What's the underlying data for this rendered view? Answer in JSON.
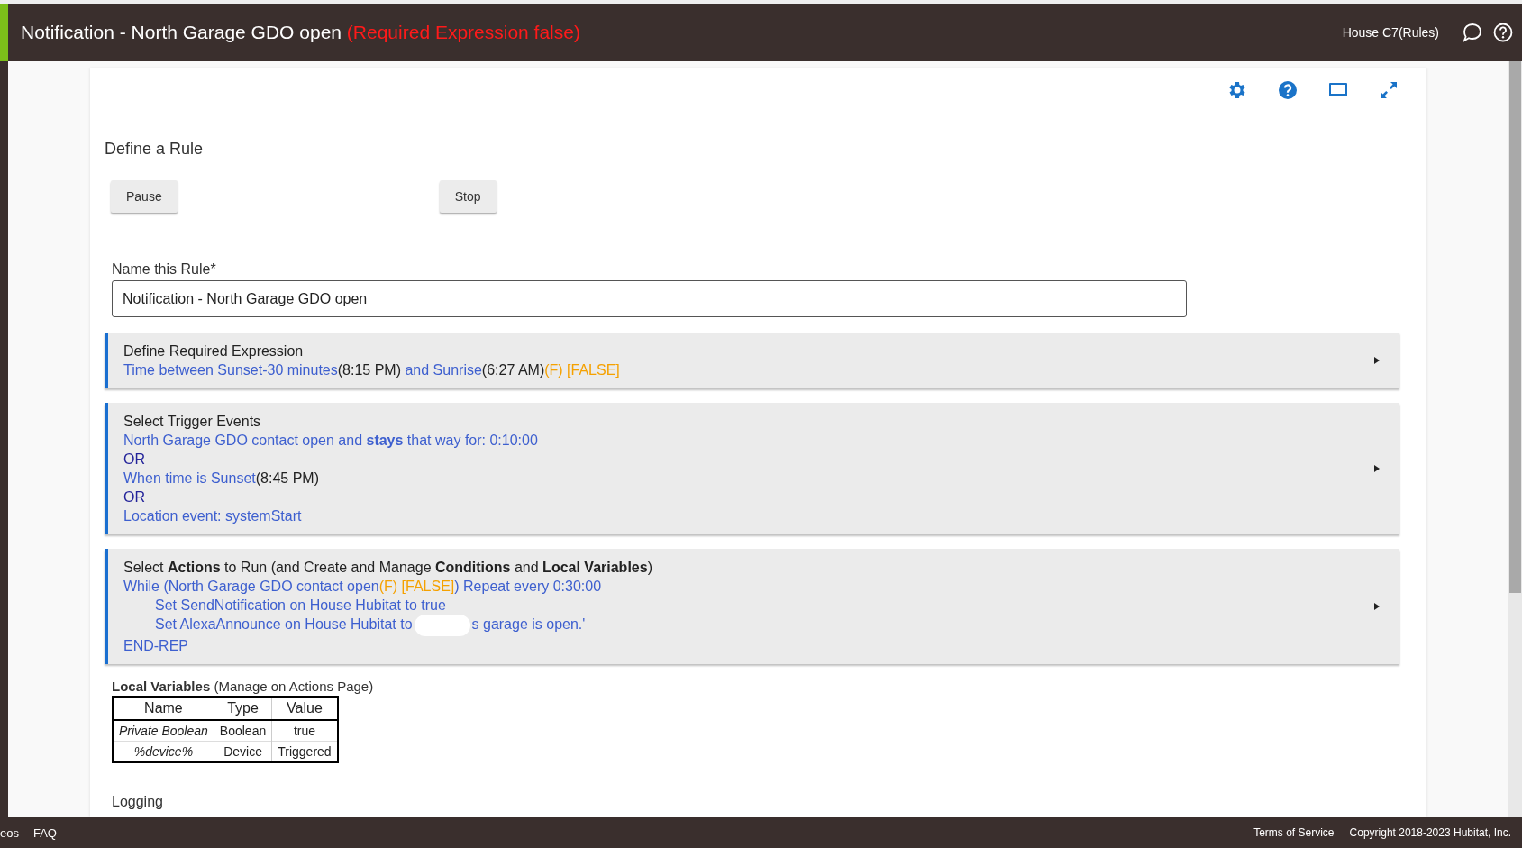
{
  "header": {
    "title": "Notification - North Garage GDO open",
    "status": "(Required Expression false)",
    "hub_name": "House C7(Rules)"
  },
  "page_title": "Define a Rule",
  "buttons": [
    {
      "label": "Pause"
    },
    {
      "label": "Stop"
    }
  ],
  "name_field": {
    "label": "Name this Rule*",
    "value": "Notification - North Garage GDO open"
  },
  "sections": [
    {
      "title": "Define Required Expression",
      "lines": [
        {
          "indent": false,
          "segments": [
            {
              "kind": "link",
              "text": "Time between Sunset-30 minutes"
            },
            {
              "kind": "plain",
              "text": "(8:15 PM)"
            },
            {
              "kind": "link",
              "text": " and Sunrise"
            },
            {
              "kind": "plain",
              "text": "(6:27 AM)"
            },
            {
              "kind": "status",
              "text": "(F) [FALSE]"
            }
          ]
        }
      ]
    },
    {
      "title": "Select Trigger Events",
      "lines": [
        {
          "indent": false,
          "segments": [
            {
              "kind": "link",
              "text": "North Garage GDO contact open and **stays** that way for: 0:10:00"
            }
          ]
        },
        {
          "indent": false,
          "segments": [
            {
              "kind": "or",
              "text": "OR"
            }
          ]
        },
        {
          "indent": false,
          "segments": [
            {
              "kind": "link",
              "text": "When time is Sunset"
            },
            {
              "kind": "plain",
              "text": "(8:45 PM)"
            }
          ]
        },
        {
          "indent": false,
          "segments": [
            {
              "kind": "or",
              "text": "OR"
            }
          ]
        },
        {
          "indent": false,
          "segments": [
            {
              "kind": "link",
              "text": "Location event: systemStart"
            }
          ]
        }
      ]
    },
    {
      "title": "Select **Actions** to Run (and Create and Manage **Conditions** and **Local Variables**)",
      "lines": [
        {
          "indent": false,
          "segments": [
            {
              "kind": "link",
              "text": "While (North Garage GDO contact open"
            },
            {
              "kind": "status",
              "text": "(F) [FALSE]"
            },
            {
              "kind": "link",
              "text": ") Repeat every 0:30:00"
            }
          ]
        },
        {
          "indent": true,
          "segments": [
            {
              "kind": "link",
              "text": "Set SendNotification on House Hubitat to true"
            }
          ]
        },
        {
          "indent": true,
          "segments": [
            {
              "kind": "link",
              "text": "Set AlexaAnnounce on House Hubitat to"
            },
            {
              "kind": "redaction"
            },
            {
              "kind": "link",
              "text": "s garage is open.'"
            }
          ]
        },
        {
          "indent": false,
          "segments": [
            {
              "kind": "link",
              "text": "END-REP"
            }
          ]
        }
      ]
    }
  ],
  "local_variables": {
    "title": "**Local Variables** (Manage on Actions Page)",
    "columns": [
      "Name",
      "Type",
      "Value"
    ],
    "rows": [
      [
        "Private Boolean",
        "Boolean",
        "true"
      ],
      [
        "%device%",
        "Device",
        "Triggered"
      ]
    ]
  },
  "next_section": "Logging",
  "footer": {
    "left_links": [
      "eos",
      "FAQ"
    ],
    "right_links": [
      "Terms of Service",
      "Copyright 2018-2023 Hubitat, Inc."
    ]
  }
}
